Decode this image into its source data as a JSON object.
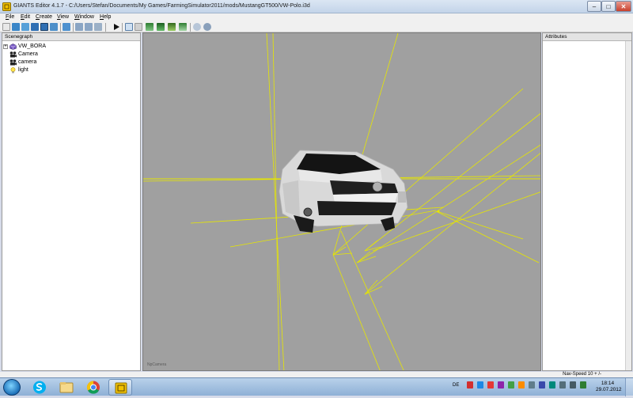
{
  "window": {
    "title": "GIANTS Editor 4.1.7 - C:/Users/Stefan/Documents/My Games/FarmingSimulator2011/mods/MustangGT500/VW-Polo.i3d",
    "minimize_glyph": "‒",
    "maximize_glyph": "□",
    "close_glyph": "✕"
  },
  "menu": {
    "items": [
      "File",
      "Edit",
      "Create",
      "View",
      "Window",
      "Help"
    ]
  },
  "toolbar": {
    "icons": [
      "new-icon",
      "open-icon",
      "import-icon",
      "save-icon",
      "save-as-icon",
      "reload-icon",
      "undo-icon",
      "redo-icon",
      "play-icon",
      "select-icon",
      "magnet-icon",
      "terrain-icon",
      "paint-icon",
      "foliage-icon",
      "grass-icon",
      "settings-icon",
      "camera-settings-icon"
    ]
  },
  "scenegraph": {
    "header": "Scenegraph",
    "expand_glyph": "+",
    "items": [
      {
        "label": "VW_BORA",
        "icon": "cube-icon"
      },
      {
        "label": "Camera",
        "icon": "camera-icon"
      },
      {
        "label": "camera",
        "icon": "camera-icon"
      },
      {
        "label": "light",
        "icon": "lightbulb-icon"
      }
    ]
  },
  "attributes": {
    "header": "Attributes"
  },
  "viewport": {
    "camera_label": "NpCamera",
    "background_color": "#a0a0a0",
    "line_color": "#e6e600"
  },
  "statusbar": {
    "nav_speed": "Nav-Speed 10 + /-"
  },
  "taskbar": {
    "apps": [
      "skype-icon",
      "explorer-icon",
      "chrome-icon",
      "giants-editor-icon"
    ],
    "language": "DE",
    "clock_time": "18:14",
    "clock_date": "29.07.2012"
  }
}
